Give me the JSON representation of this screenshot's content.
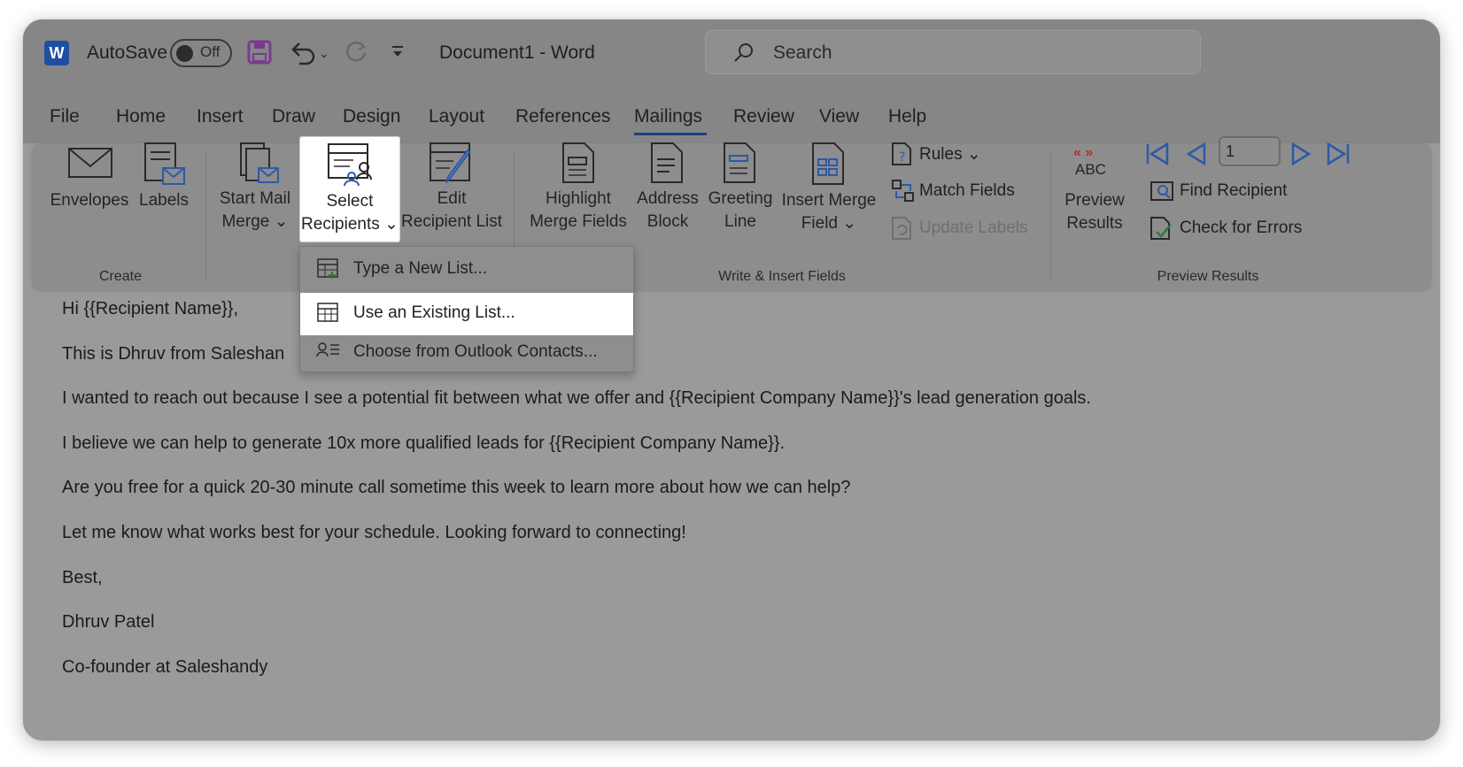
{
  "titlebar": {
    "autosave_label": "AutoSave",
    "autosave_state": "Off",
    "doc_title": "Document1  -  Word",
    "search_placeholder": "Search"
  },
  "tabs": [
    "File",
    "Home",
    "Insert",
    "Draw",
    "Design",
    "Layout",
    "References",
    "Mailings",
    "Review",
    "View",
    "Help"
  ],
  "active_tab": "Mailings",
  "ribbon": {
    "create": {
      "envelopes": "Envelopes",
      "labels": "Labels",
      "group_label": "Create"
    },
    "start_mail_merge": {
      "line1": "Start Mail",
      "line2": "Merge ⌄"
    },
    "select_recipients": {
      "line1": "Select",
      "line2": "Recipients ⌄"
    },
    "edit_recipient_list": {
      "line1": "Edit",
      "line2": "Recipient List"
    },
    "highlight_merge_fields": {
      "line1": "Highlight",
      "line2": "Merge Fields"
    },
    "address_block": {
      "line1": "Address",
      "line2": "Block"
    },
    "greeting_line": {
      "line1": "Greeting",
      "line2": "Line"
    },
    "insert_merge_field": {
      "line1": "Insert Merge",
      "line2": "Field ⌄"
    },
    "rules": "Rules ⌄",
    "match_fields": "Match Fields",
    "update_labels": "Update Labels",
    "write_insert_group_label": "Write & Insert Fields",
    "preview_results": {
      "abc": "ABC",
      "line1": "Preview",
      "line2": "Results"
    },
    "record_number": "1",
    "find_recipient": "Find Recipient",
    "check_for_errors": "Check for Errors",
    "preview_group_label": "Preview Results"
  },
  "dropdown": {
    "items": [
      {
        "label": "Type a New List...",
        "highlighted": false
      },
      {
        "label": "Use an Existing List...",
        "highlighted": true
      },
      {
        "label": "Choose from Outlook Contacts...",
        "highlighted": false
      }
    ]
  },
  "document": {
    "lines": [
      "Hi {{Recipient Name}},",
      "This is Dhruv from Saleshan",
      "I wanted to reach out because I see a potential fit between what we offer and {{Recipient Company Name}}'s lead generation goals.",
      "I believe we can help to generate 10x more qualified leads for {{Recipient Company Name}}.",
      "Are you free for a quick 20-30 minute call sometime this week to learn more about how we can help?",
      "Let me know what works best for your schedule. Looking forward to connecting!",
      "Best,",
      "Dhruv Patel",
      "Co-founder at Saleshandy"
    ]
  },
  "colors": {
    "overlay_gray": "#9a9a9a",
    "active_tab_underline": "#1e3f82",
    "word_blue": "#1e4f9f",
    "save_icon": "#7a3b8f",
    "accent_red": "#b2302c",
    "icon_blue": "#2b5aa8"
  }
}
